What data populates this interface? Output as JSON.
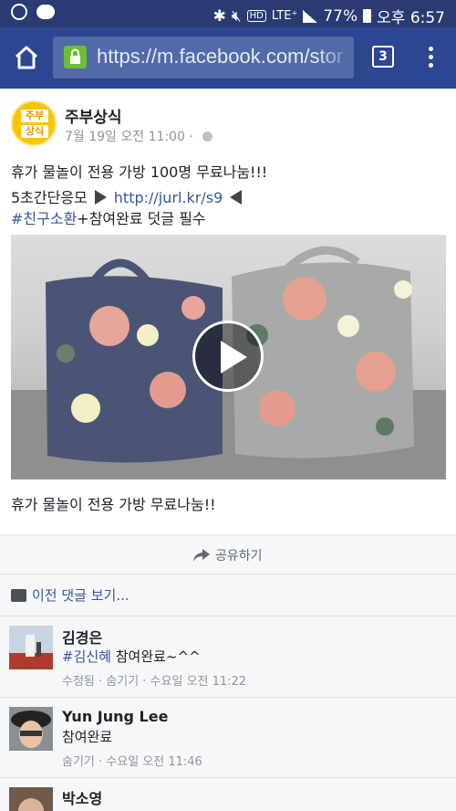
{
  "status_bar": {
    "network": "LTE⁺",
    "battery": "77%",
    "time": "오후 6:57",
    "hd": "HD"
  },
  "browser": {
    "url": "https://m.facebook.com/stor",
    "tab_count": "3"
  },
  "post": {
    "page_name": "주부상식",
    "logo_line1": "주부",
    "logo_line2": "상식",
    "timestamp": "7월 19일 오전 11:00 · ",
    "line1": "휴가 물놀이 전용 가방 100명 무료나눔!!!",
    "line2_prefix": "5초간단응모",
    "line2_link": "http://jurl.kr/s9",
    "line3_hashtag": "#친구소환",
    "line3_rest": "+참여완료 덧글 필수",
    "video_caption": "휴가 물놀이 전용 가방 무료나눔!!",
    "share_label": "공유하기"
  },
  "comments_section": {
    "previous_link": "이전 댓글 보기...",
    "comments": [
      {
        "name": "김경은",
        "mention": "#김신혜",
        "text": " 참여완료~^^",
        "meta": "수정됨 · 숨기기 · 수요일 오전 11:22"
      },
      {
        "name": "Yun Jung Lee",
        "mention": "",
        "text": "참여완료",
        "meta": "숨기기 · 수요일 오전 11:46"
      },
      {
        "name": "박소영",
        "mention": "",
        "text": "",
        "meta": ""
      }
    ]
  },
  "colors": {
    "status_bar": "#2a3a73",
    "toolbar": "#2e4592",
    "link": "#365899",
    "secondary_bg": "#f6f7f9"
  }
}
